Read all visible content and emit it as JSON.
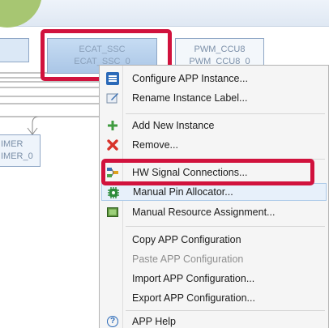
{
  "blocks": {
    "ecat_type": "ECAT_SSC",
    "ecat_instance": "ECAT_SSC_0",
    "pwm_type": "PWM_CCU8",
    "pwm_instance": "PWM_CCU8_0",
    "timer_type": "IMER",
    "timer_instance": "IMER_0"
  },
  "context_menu": {
    "items": [
      {
        "label": "Configure APP Instance...",
        "icon": "configure-icon"
      },
      {
        "label": "Rename Instance Label...",
        "icon": "rename-icon"
      },
      {
        "label": "Add New Instance",
        "icon": "add-icon"
      },
      {
        "label": "Remove...",
        "icon": "remove-icon"
      },
      {
        "label": "HW Signal Connections...",
        "icon": "hw-signal-icon"
      },
      {
        "label": "Manual Pin Allocator...",
        "icon": "pin-allocator-icon"
      },
      {
        "label": "Manual Resource Assignment...",
        "icon": "resource-icon"
      },
      {
        "label": "Copy APP Configuration",
        "icon": ""
      },
      {
        "label": "Paste APP Configuration",
        "icon": ""
      },
      {
        "label": "Import APP Configuration...",
        "icon": ""
      },
      {
        "label": "Export APP Configuration...",
        "icon": ""
      },
      {
        "label": "APP Help",
        "icon": "help-icon"
      }
    ]
  },
  "colors": {
    "highlight": "#d1123d",
    "accent_green": "#a7c672",
    "selected_block": "#b3cdea"
  }
}
